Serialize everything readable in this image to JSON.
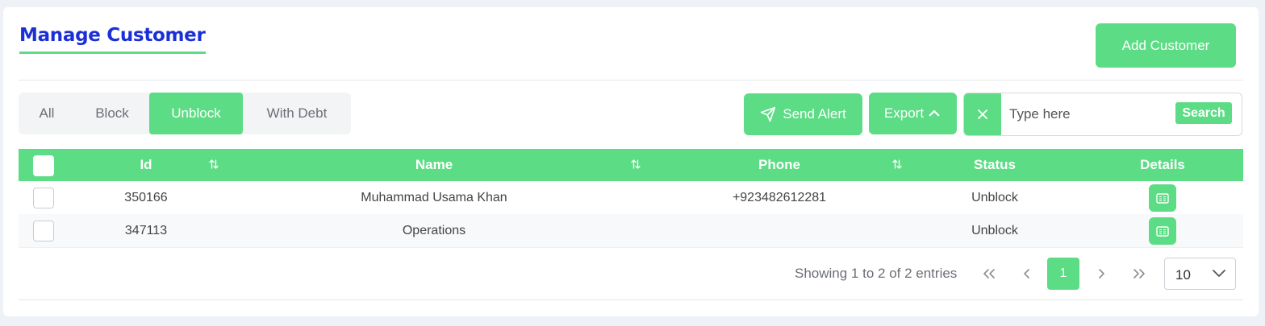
{
  "header": {
    "title": "Manage Customer",
    "add_button": "Add Customer"
  },
  "tabs": [
    {
      "label": "All",
      "active": false
    },
    {
      "label": "Block",
      "active": false
    },
    {
      "label": "Unblock",
      "active": true
    },
    {
      "label": "With Debt",
      "active": false
    }
  ],
  "toolbar": {
    "send_alert": "Send Alert",
    "send_alert_icon": "send-icon",
    "export": "Export",
    "export_icon": "chevron-up-icon",
    "search_placeholder": "Type here",
    "search_value": "",
    "search_button": "Search",
    "clear_icon": "close-icon"
  },
  "table": {
    "columns": [
      "Id",
      "Name",
      "Phone",
      "Status",
      "Details"
    ],
    "rows": [
      {
        "id": "350166",
        "name": "Muhammad Usama Khan",
        "phone": "+923482612281",
        "status": "Unblock"
      },
      {
        "id": "347113",
        "name": "Operations",
        "phone": "",
        "status": "Unblock"
      }
    ]
  },
  "pagination": {
    "summary": "Showing 1 to 2 of 2 entries",
    "current_page": "1",
    "page_size": "10"
  },
  "colors": {
    "accent": "#5cdc84",
    "title": "#1b2fd6"
  }
}
